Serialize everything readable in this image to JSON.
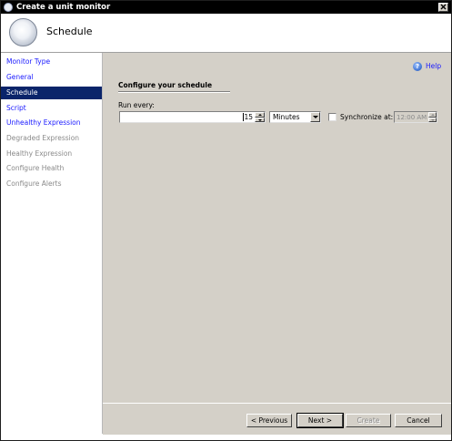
{
  "window": {
    "title": "Create a unit monitor"
  },
  "header": {
    "title": "Schedule"
  },
  "sidebar": {
    "items": [
      {
        "label": "Monitor Type"
      },
      {
        "label": "General"
      },
      {
        "label": "Schedule"
      },
      {
        "label": "Script"
      },
      {
        "label": "Unhealthy Expression"
      },
      {
        "label": "Degraded Expression"
      },
      {
        "label": "Healthy Expression"
      },
      {
        "label": "Configure Health"
      },
      {
        "label": "Configure Alerts"
      }
    ]
  },
  "main": {
    "help_label": "Help",
    "section_title": "Configure your schedule",
    "run_every_label": "Run every:",
    "run_every_value": "15",
    "unit_value": "Minutes",
    "synchronize_label": "Synchronize at:",
    "synchronize_checked": false,
    "synchronize_time": "12:00 AM"
  },
  "footer": {
    "previous_label": "< Previous",
    "next_label": "Next >",
    "create_label": "Create",
    "cancel_label": "Cancel"
  }
}
